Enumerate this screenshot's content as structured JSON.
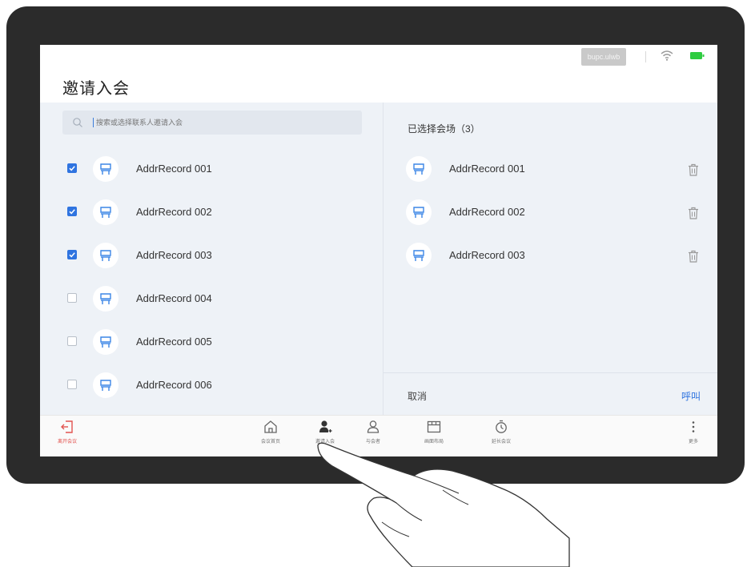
{
  "status_bar": {
    "network_badge": "bupc.ulwb",
    "wifi_icon": "wifi-icon",
    "battery_icon": "battery-icon",
    "battery_color": "#2ecc40"
  },
  "page": {
    "title": "邀请入会"
  },
  "search": {
    "placeholder": "搜索或选择联系人邀请入会"
  },
  "contacts": [
    {
      "name": "AddrRecord 001",
      "checked": true
    },
    {
      "name": "AddrRecord 002",
      "checked": true
    },
    {
      "name": "AddrRecord 003",
      "checked": true
    },
    {
      "name": "AddrRecord 004",
      "checked": false
    },
    {
      "name": "AddrRecord 005",
      "checked": false
    },
    {
      "name": "AddrRecord 006",
      "checked": false
    }
  ],
  "selected": {
    "header": "已选择会场（3）",
    "items": [
      {
        "name": "AddrRecord 001"
      },
      {
        "name": "AddrRecord 002"
      },
      {
        "name": "AddrRecord 003"
      }
    ],
    "cancel_label": "取消",
    "call_label": "呼叫"
  },
  "toolbar": {
    "leave_label": "离开会议",
    "home_label": "会议首页",
    "invite_label": "邀请入会",
    "participants_label": "与会者",
    "layout_label": "画面布局",
    "extend_label": "延长会议",
    "more_label": "更多"
  },
  "colors": {
    "accent": "#2f74e0",
    "danger": "#e2534f",
    "panel_bg": "#eef2f7",
    "device_frame": "#2b2b2b"
  }
}
